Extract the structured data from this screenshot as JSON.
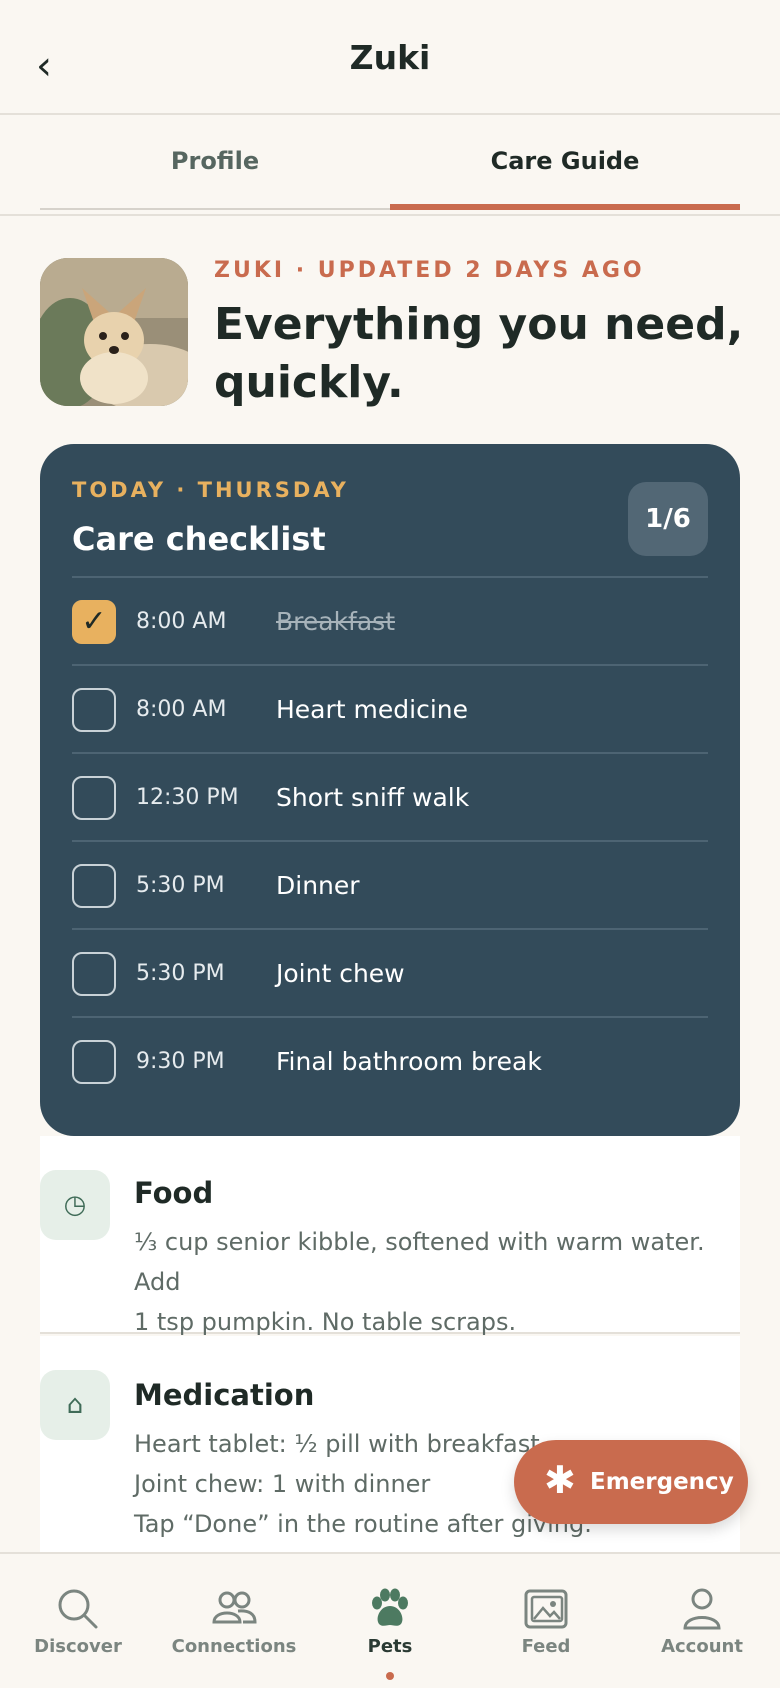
{
  "header": {
    "back_icon": "chevron-left-icon",
    "title": "Zuki"
  },
  "tabs": [
    {
      "label": "Profile",
      "active": false
    },
    {
      "label": "Care Guide",
      "active": true
    }
  ],
  "hero": {
    "eyebrow": "ZUKI · UPDATED 2 DAYS AGO",
    "headline": "Everything you need, quickly."
  },
  "checklist": {
    "eyebrow": "TODAY · THURSDAY",
    "title": "Care checklist",
    "count": "1/6",
    "items": [
      {
        "time": "8:00 AM",
        "label": "Breakfast",
        "done": true
      },
      {
        "time": "8:00 AM",
        "label": "Heart medicine",
        "done": false
      },
      {
        "time": "12:30 PM",
        "label": "Short sniff walk",
        "done": false
      },
      {
        "time": "5:30 PM",
        "label": "Dinner",
        "done": false
      },
      {
        "time": "5:30 PM",
        "label": "Joint chew",
        "done": false
      },
      {
        "time": "9:30 PM",
        "label": "Final bathroom break",
        "done": false
      }
    ]
  },
  "food": {
    "icon": "clock-icon",
    "title": "Food",
    "line1": "⅓ cup senior kibble, softened with warm water. Add",
    "line2": "1 tsp pumpkin. No table scraps."
  },
  "medication": {
    "icon": "home-icon",
    "title": "Medication",
    "line1": "Heart tablet: ½ pill with breakfast",
    "line2": "Joint chew: 1 with dinner",
    "line3": "Tap “Done” in the routine after giving."
  },
  "emergency": {
    "label": "Emergency"
  },
  "nav": [
    {
      "label": "Discover",
      "icon": "search-icon"
    },
    {
      "label": "Connections",
      "icon": "people-icon"
    },
    {
      "label": "Pets",
      "icon": "paw-icon",
      "active": true
    },
    {
      "label": "Feed",
      "icon": "image-icon"
    },
    {
      "label": "Account",
      "icon": "person-icon"
    }
  ],
  "colors": {
    "accent": "#c96b4e",
    "panel": "#334b5a",
    "gold": "#e8b15f",
    "green": "#4d7a61"
  }
}
